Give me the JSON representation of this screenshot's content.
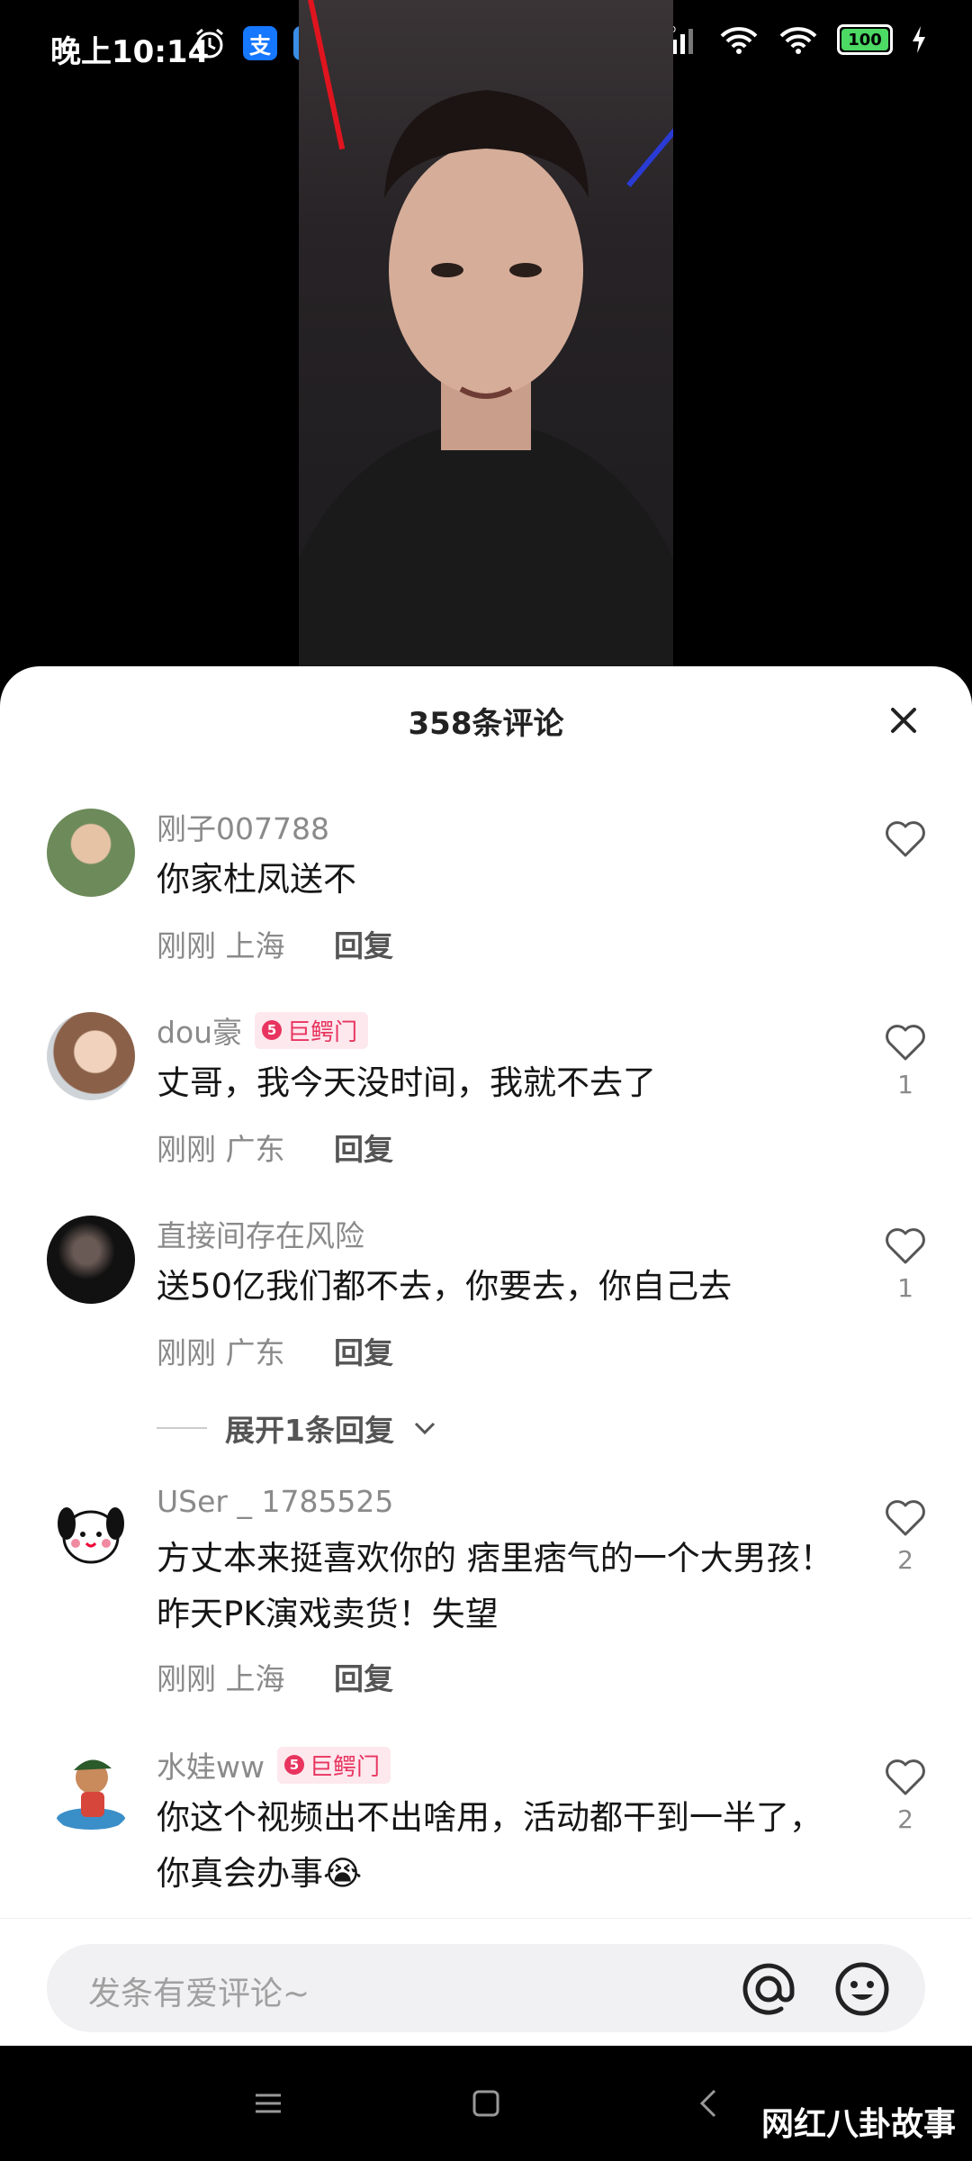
{
  "status_bar": {
    "time": "晚上10:14",
    "app_icons": [
      "alarm-icon",
      "alipay-icon",
      "app-icon",
      "shield-app-icon"
    ],
    "more": "···",
    "battery_level": "100",
    "right_icons": [
      "bluetooth-icon",
      "hd-signal-icon",
      "wifi-icon",
      "wifi-icon",
      "battery-icon",
      "charging-icon"
    ]
  },
  "comments_panel": {
    "title": "358条评论",
    "close_icon": "close-icon"
  },
  "comments": [
    {
      "username": "刚子007788",
      "badge": "",
      "text": "你家杜凤送不",
      "time": "刚刚",
      "location": "上海",
      "reply": "回复",
      "likes": ""
    },
    {
      "username": "dou豪",
      "badge": "巨鳄门",
      "badge_level": "5",
      "text": "丈哥，我今天没时间，我就不去了",
      "time": "刚刚",
      "location": "广东",
      "reply": "回复",
      "likes": "1"
    },
    {
      "username": "直接间存在风险",
      "badge": "",
      "text": "送50亿我们都不去，你要去，你自己去",
      "time": "刚刚",
      "location": "广东",
      "reply": "回复",
      "likes": "1"
    },
    {
      "username": "USer _ 1785525",
      "badge": "",
      "text": "方丈本来挺喜欢你的 痞里痞气的一个大男孩！昨天PK演戏卖货！失望",
      "time": "刚刚",
      "location": "上海",
      "reply": "回复",
      "likes": "2"
    },
    {
      "username": "水娃ᴡᴡ",
      "badge": "巨鳄门",
      "badge_level": "5",
      "text": "你这个视频出不出啥用，活动都干到一半了，你真会办事😭",
      "time": "",
      "location": "",
      "reply": "",
      "likes": "2"
    }
  ],
  "expand_replies": "展开1条回复",
  "input": {
    "placeholder": "发条有爱评论~",
    "at_icon": "at-icon",
    "emoji_icon": "emoji-icon"
  },
  "navigation": {
    "menu_icon": "menu-icon",
    "home_icon": "home-icon",
    "back_icon": "back-icon"
  },
  "watermark": "网红八卦故事",
  "colors": {
    "accent_badge": "#e8345f",
    "badge_bg": "#fde8ee",
    "text_primary": "#161616",
    "text_secondary": "#8a8a8a"
  }
}
